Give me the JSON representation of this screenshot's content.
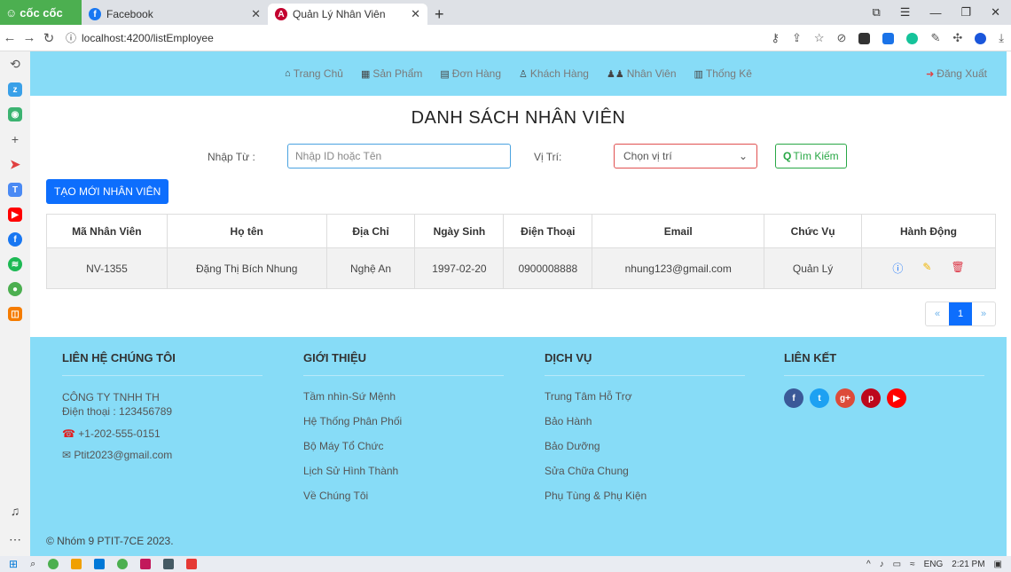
{
  "browser": {
    "brand": "cốc cốc",
    "tabs": [
      {
        "label": "Facebook"
      },
      {
        "label": "Quản Lý Nhân Viên"
      }
    ],
    "url": "localhost:4200/listEmployee"
  },
  "nav": {
    "items": [
      {
        "label": "Trang Chủ"
      },
      {
        "label": "Sản Phẩm"
      },
      {
        "label": "Đơn Hàng"
      },
      {
        "label": "Khách Hàng"
      },
      {
        "label": "Nhân Viên"
      },
      {
        "label": "Thống Kê"
      }
    ],
    "logout": "Đăng Xuất"
  },
  "main": {
    "title": "DANH SÁCH NHÂN VIÊN",
    "search_label": "Nhập Từ :",
    "search_placeholder": "Nhập ID hoặc Tên",
    "position_label": "Vị Trí:",
    "position_selected": "Chọn vị trí",
    "search_button": "Tìm Kiếm",
    "create_button": "TẠO MỚI NHÂN VIÊN"
  },
  "table": {
    "headers": [
      "Mã Nhân Viên",
      "Họ tên",
      "Địa Chỉ",
      "Ngày Sinh",
      "Điện Thoại",
      "Email",
      "Chức Vụ",
      "Hành Động"
    ],
    "rows": [
      [
        "NV-1355",
        "Đặng Thị Bích Nhung",
        "Nghệ An",
        "1997-02-20",
        "0900008888",
        "nhung123@gmail.com",
        "Quản Lý"
      ]
    ]
  },
  "pagination": {
    "prev": "«",
    "current": "1",
    "next": "»"
  },
  "footer": {
    "contact": {
      "title": "LIÊN HỆ CHÚNG TÔI",
      "company": "CÔNG TY TNHH TH",
      "phone": "Điện thoại : 123456789",
      "phone2": "+1-202-555-0151",
      "email": "Ptit2023@gmail.com"
    },
    "about": {
      "title": "GIỚI THIỆU",
      "items": [
        "Tầm nhìn-Sứ Mệnh",
        "Hệ Thống Phân Phối",
        "Bộ Máy Tổ Chức",
        "Lịch Sử Hình Thành",
        "Về Chúng Tôi"
      ]
    },
    "services": {
      "title": "DỊCH VỤ",
      "items": [
        "Trung Tâm Hỗ Trợ",
        "Bảo Hành",
        "Bảo Dưỡng",
        "Sửa Chữa Chung",
        "Phụ Tùng & Phụ Kiện"
      ]
    },
    "links": {
      "title": "LIÊN KẾT"
    },
    "copyright": "© Nhóm 9 PTIT-7CE 2023."
  },
  "taskbar": {
    "lang": "ENG",
    "time": "2:21 PM"
  },
  "colors": {
    "nav_bg": "#87dcf7",
    "primary": "#0d6efd",
    "success": "#28a745"
  }
}
